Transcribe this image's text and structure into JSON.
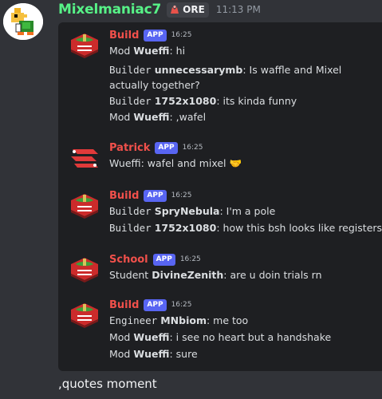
{
  "author": {
    "name": "Mixelmaniac7",
    "clan_tag": "ORE",
    "timestamp": "11:13 PM"
  },
  "messages": [
    {
      "bot": "Build",
      "badge": "APP",
      "time": "16:25",
      "lines": [
        {
          "role": "Mod",
          "user": "Wueffi",
          "text": ":  hi"
        },
        {
          "role": "Builder",
          "user": "unnecessarymb",
          "text": ":  Is waffle and Mixel actually together?"
        },
        {
          "role": "Builder",
          "user": "1752x1080",
          "text": ":  its kinda funny"
        },
        {
          "role": "Mod",
          "user": "Wueffi",
          "text": ":  ,wafel"
        }
      ]
    },
    {
      "bot": "Patrick",
      "badge": "APP",
      "time": "16:25",
      "lines": [
        {
          "role": "",
          "user": "",
          "text": "Wueffi: wafel and mixel 🤝"
        }
      ]
    },
    {
      "bot": "Build",
      "badge": "APP",
      "time": "16:25",
      "lines": [
        {
          "role": "Builder",
          "user": "SpryNebula",
          "text": ":  I'm a pole"
        },
        {
          "role": "Builder",
          "user": "1752x1080",
          "text": ":  how this bsh looks like registers"
        }
      ]
    },
    {
      "bot": "School",
      "badge": "APP",
      "time": "16:25",
      "lines": [
        {
          "role": "Student",
          "user": "DivineZenith",
          "text": ":  are u doin trials rn"
        }
      ]
    },
    {
      "bot": "Build",
      "badge": "APP",
      "time": "16:25",
      "lines": [
        {
          "role": "Engineer",
          "user": "MNbiom",
          "text": ":  me too"
        },
        {
          "role": "Mod",
          "user": "Wueffi",
          "text": ":  i see no heart but a handshake"
        },
        {
          "role": "Mod",
          "user": "Wueffi",
          "text": ":  sure"
        }
      ]
    }
  ],
  "composer": {
    "text": ",quotes moment"
  },
  "colors": {
    "background": "#313338",
    "embed": "#1e1f22",
    "author_name": "#57f287",
    "bot_name": "#f0504b",
    "app_badge": "#5865f2",
    "logo_red": "#cc2b2b"
  }
}
